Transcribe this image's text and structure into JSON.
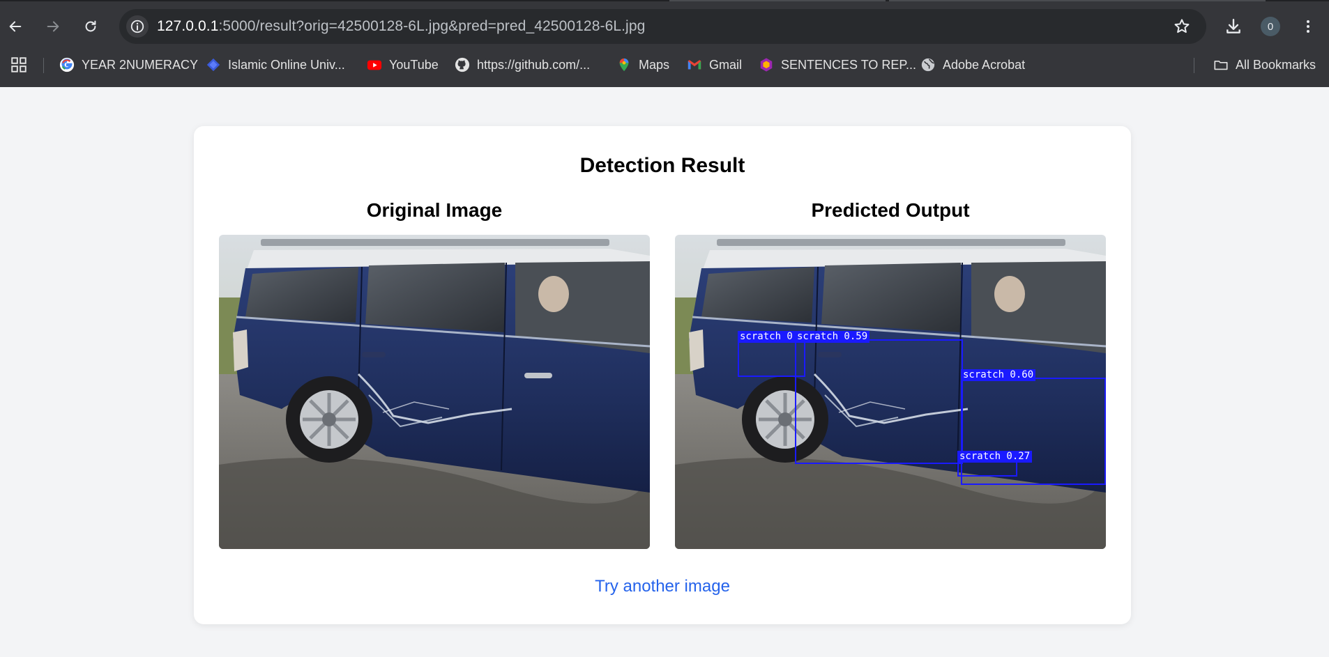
{
  "browser": {
    "url_host": "127.0.0.1",
    "url_rest": ":5000/result?orig=42500128-6L.jpg&pred=pred_42500128-6L.jpg",
    "profile_count": "0"
  },
  "bookmarks": [
    {
      "label": "YEAR 2NUMERACY",
      "icon": "google-icon"
    },
    {
      "label": "Islamic Online Univ...",
      "icon": "diamond-icon"
    },
    {
      "label": "YouTube",
      "icon": "youtube-icon"
    },
    {
      "label": "https://github.com/...",
      "icon": "github-icon"
    },
    {
      "label": "Maps",
      "icon": "maps-pin-icon"
    },
    {
      "label": "Gmail",
      "icon": "gmail-icon"
    },
    {
      "label": "SENTENCES TO REP...",
      "icon": "hexagon-app-icon"
    },
    {
      "label": "Adobe Acrobat",
      "icon": "globe-icon"
    }
  ],
  "all_bookmarks_label": "All Bookmarks",
  "page": {
    "title": "Detection Result",
    "original_heading": "Original Image",
    "predicted_heading": "Predicted Output",
    "try_again": "Try another image"
  },
  "detections": [
    {
      "label": "scratch 0."
    },
    {
      "label": "scratch 0.59"
    },
    {
      "label": "scratch 0.60"
    },
    {
      "label": "scratch 0.27"
    }
  ],
  "colors": {
    "chrome_bg": "#35363a",
    "page_bg": "#f3f4f6",
    "link": "#2563eb",
    "detection_box": "#1a1aff"
  }
}
